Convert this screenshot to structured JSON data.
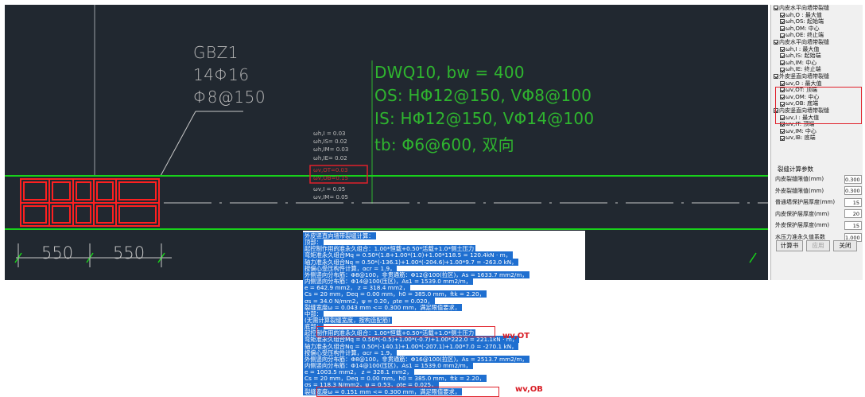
{
  "cad": {
    "gbz": {
      "name": "GBZ1",
      "rebar": "14Φ16",
      "stirrup": "Φ8@150"
    },
    "dwq": {
      "name": "DWQ10, bw = 400",
      "os": "OS: HΦ12@150, VΦ8@100",
      "is": "IS: HΦ12@150, VΦ14@100",
      "tb": "tb: Φ6@600, 双向"
    },
    "crack_labels": [
      "ωh,I = 0.03",
      "ωh,IS= 0.02",
      "ωh,IM= 0.03",
      "ωh,IE= 0.02",
      "ωv,OT=0.03",
      "ωv,OB=0.15",
      "ωv,I = 0.05",
      "ωv,IM= 0.05"
    ],
    "dims": [
      "550",
      "550"
    ]
  },
  "panel": {
    "tree": [
      {
        "label": "内皮水平向墙带裂缝",
        "level": 0,
        "checked": true
      },
      {
        "label": "ωh,O : 最大值",
        "level": 1,
        "checked": true
      },
      {
        "label": "ωh,OS: 起始端",
        "level": 1,
        "checked": true
      },
      {
        "label": "ωh,OM: 中心",
        "level": 1,
        "checked": true
      },
      {
        "label": "ωh,OE: 终止端",
        "level": 1,
        "checked": true
      },
      {
        "label": "内皮水平向墙带裂缝",
        "level": 0,
        "checked": true
      },
      {
        "label": "ωh,I : 最大值",
        "level": 1,
        "checked": true
      },
      {
        "label": "ωh,IS: 起始端",
        "level": 1,
        "checked": true
      },
      {
        "label": "ωh,IM: 中心",
        "level": 1,
        "checked": true
      },
      {
        "label": "ωh,IE: 终止端",
        "level": 1,
        "checked": true
      },
      {
        "label": "外皮竖直向墙带裂缝",
        "level": 0,
        "checked": true
      },
      {
        "label": "ωv,O : 最大值",
        "level": 1,
        "checked": true
      },
      {
        "label": "ωv,OT: 顶端",
        "level": 1,
        "checked": true
      },
      {
        "label": "ωv,OM: 中心",
        "level": 1,
        "checked": true
      },
      {
        "label": "ωv,OB: 底端",
        "level": 1,
        "checked": true
      },
      {
        "label": "内皮竖直向墙带裂缝",
        "level": 0,
        "checked": true
      },
      {
        "label": "ωv,I : 最大值",
        "level": 1,
        "checked": true
      },
      {
        "label": "ωv,IT: 顶端",
        "level": 1,
        "checked": true
      },
      {
        "label": "ωv,IM: 中心",
        "level": 1,
        "checked": true
      },
      {
        "label": "ωv,IB: 底端",
        "level": 1,
        "checked": true
      }
    ],
    "params_title": "裂缝计算参数",
    "params": [
      {
        "label": "内皮裂缝限值(mm)",
        "value": "0.300"
      },
      {
        "label": "外皮裂缝限值(mm)",
        "value": "0.300"
      },
      {
        "label": "普通墙保护层厚度(mm)",
        "value": "15"
      },
      {
        "label": "内皮保护层厚度(mm)",
        "value": "20"
      },
      {
        "label": "外皮保护层厚度(mm)",
        "value": "15"
      },
      {
        "label": "水压力准永久值系数",
        "value": "1.000"
      }
    ],
    "buttons": {
      "calc": "计算书",
      "apply": "应用",
      "close": "关闭"
    }
  },
  "calc": {
    "lines": [
      "外皮竖直向墙带裂缝计算：",
      "顶部：",
      "    起控制作用的准永久组合：1.00*恒载+0.50*活载+1.0*侧土压力",
      "    弯矩准永久组合Mq = 0.50*(1.8+1.00*(1.0)+1.00*118.5 = 120.4kN · m，",
      "    轴力准永久组合Nq = 0.50*(-136.1)+1.00*(-204.6)+1.00*9.7 = -263.0 kN，",
      "    按偏心受压构件计算，αcr = 1.9，",
      "    外侧竖向分布筋：Φ8@100，非贯通筋：Φ12@100(拉区)，As = 1633.7 mm2/m，",
      "    内侧竖向分布筋：Φ14@100(压区)，As1 = 1539.0 mm2/m，",
      "    e = 642.9 mm2， z = 318.4 mm2，",
      "    Cs = 20 mm，Deq = 0.00 mm，h0 = 385.0 mm，ftk = 2.20，",
      "    σs = 34.0 N/mm2，ψ = 0.20，ρte = 0.020，",
      "    裂缝宽度ω = 0.043 mm <= 0.300 mm，满足限值要求，",
      "中部：",
      "    (无需计算裂缝宽度，按构造配筋)",
      "底部：",
      "    起控制作用的准永久组合：1.00*恒载+0.50*活载+1.0*侧土压力",
      "    弯矩准永久组合Mq = 0.50*(-0.5)+1.00*(-0.7)+1.00*222.0 = 221.1kN · m，",
      "    轴力准永久组合Nq = 0.50*(-140.1)+1.00*(-207.1)+1.00*7.0 = -270.1 kN，",
      "    按偏心受压构件计算，αcr = 1.9，",
      "    外侧竖向分布筋：Φ8@100，非贯通筋：Φ16@100(拉区)，As = 2513.7 mm2/m，",
      "    内侧竖向分布筋：Φ14@100(压区)，As1 = 1539.0 mm2/m，",
      "    e = 1003.5 mm2， z = 328.1 mm2，",
      "    Cs = 20 mm，Deq = 0.00 mm，h0 = 385.0 mm，ftk = 2.20，",
      "    σs = 118.3 N/mm2，ψ = 0.53，ρte = 0.025，",
      "    裂缝宽度ω = 0.151 mm <= 0.300 mm，满足限值要求，"
    ],
    "ann_ot": "wv,OT",
    "ann_ob": "wv,OB"
  },
  "colors": {
    "cad_bg": "#212830",
    "wall_green": "#18d21a",
    "column_red": "#ff2020",
    "select_blue": "#1f6fd0",
    "highlight_red": "#e0202a"
  }
}
